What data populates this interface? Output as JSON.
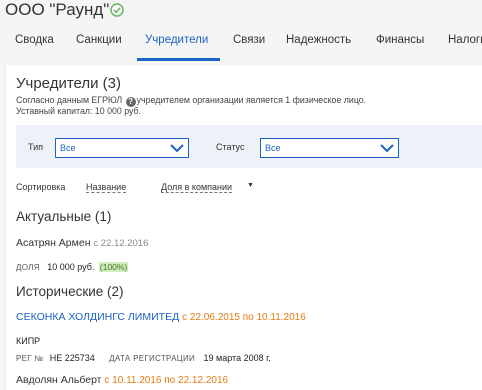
{
  "company": {
    "title": "ООО \"Раунд\""
  },
  "tabs": [
    {
      "label": "Сводка"
    },
    {
      "label": "Санкции"
    },
    {
      "label": "Учредители"
    },
    {
      "label": "Связи"
    },
    {
      "label": "Надежность"
    },
    {
      "label": "Финансы"
    },
    {
      "label": "Налоги"
    }
  ],
  "active_tab": "Учредители",
  "section": {
    "title": "Учредители (3)",
    "info_before": "Согласно данным ЕГРЮЛ",
    "info_after": "учредителем организации является 1 физическое лицо.",
    "capital": "Уставный капитал: 10 000 руб."
  },
  "filters": {
    "type_label": "Тип",
    "type_value": "Все",
    "status_label": "Статус",
    "status_value": "Все"
  },
  "sort": {
    "label": "Сортировка",
    "by_name": "Название",
    "by_share": "Доля в компании"
  },
  "current": {
    "title": "Актуальные (1)",
    "person_name": "Асатрян Армен",
    "person_since": "с 22.12.2016",
    "share_label": "ДОЛЯ",
    "share_value": "10 000 руб.",
    "share_pct": "(100%)"
  },
  "historical": {
    "title": "Исторические (2)",
    "org_name": "СЕКОНКА ХОЛДИНГС ЛИМИТЕД",
    "org_dates": "с 22.06.2015 по 10.11.2016",
    "org_country": "КИПР",
    "reg_label": "РЕГ №",
    "reg_value": "НЕ 225734",
    "regdate_label": "ДАТА РЕГИСТРАЦИИ",
    "regdate_value": "19 марта 2008 г.",
    "person2_name": "Авдолян Альберт",
    "person2_dates": "с 10.11.2016 по 22.12.2016"
  },
  "colors": {
    "accent": "#1a62c7",
    "orange": "#e87a10",
    "ok_green": "#5cb85c"
  }
}
